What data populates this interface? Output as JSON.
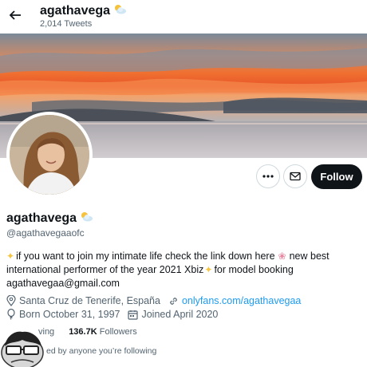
{
  "header": {
    "display_name": "agathavega",
    "tweet_count": "2,014 Tweets"
  },
  "profile": {
    "display_name": "agathavega",
    "handle": "@agathavegaaofc",
    "bio_line1": "if you want to join my intimate life check the link down here",
    "bio_line1b": "new best",
    "bio_line2": "international performer of the year 2021 Xbiz",
    "bio_line2b": "for model booking",
    "bio_line3": "agathavegaa@gmail.com",
    "location": "Santa Cruz de Tenerife, España",
    "website": "onlyfans.com/agathavegaa",
    "birthday": "Born October 31, 1997",
    "joined": "Joined April 2020",
    "following_label": "ving",
    "followers_count": "136.7K",
    "followers_label": "Followers",
    "followed_by": "ed by anyone you’re following"
  },
  "actions": {
    "follow_label": "Follow"
  },
  "icons": {
    "back": "back-arrow-icon",
    "more": "more-dots-icon",
    "mail": "mail-icon",
    "location": "location-pin-icon",
    "link": "link-icon",
    "birthday": "balloon-icon",
    "joined": "calendar-icon",
    "name_emoji": "sun-behind-cloud-icon"
  },
  "colors": {
    "accent": "#1d9bf0",
    "follow_button": "#0f1419",
    "secondary_text": "#536471"
  }
}
